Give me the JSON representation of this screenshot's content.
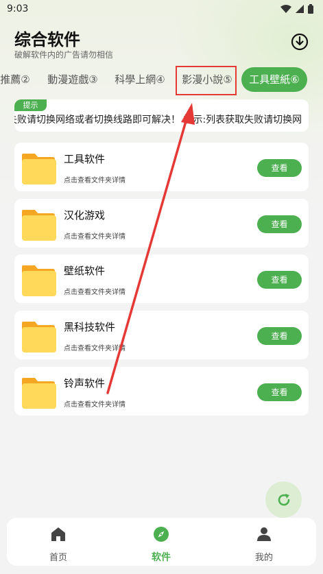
{
  "status_bar": {
    "time": "9:03"
  },
  "header": {
    "title": "综合软件",
    "subtitle": "破解软件内的广告请勿相信"
  },
  "tabs": [
    {
      "label": "推薦②",
      "active": false
    },
    {
      "label": "動漫遊戲③",
      "active": false
    },
    {
      "label": "科學上網④",
      "active": false
    },
    {
      "label": "影漫小說⑤",
      "active": false
    },
    {
      "label": "工具壁紙⑥",
      "active": true
    }
  ],
  "notice": {
    "tag": "提示",
    "text": "失败请切换网络或者切换线路即可解决！ 提示:列表获取失败请切换网"
  },
  "folders": [
    {
      "name": "工具软件",
      "desc": "点击查看文件夹详情",
      "button": "查看"
    },
    {
      "name": "汉化游戏",
      "desc": "点击查看文件夹详情",
      "button": "查看"
    },
    {
      "name": "壁纸软件",
      "desc": "点击查看文件夹详情",
      "button": "查看"
    },
    {
      "name": "黑科技软件",
      "desc": "点击查看文件夹详情",
      "button": "查看"
    },
    {
      "name": "铃声软件",
      "desc": "点击查看文件夹详情",
      "button": "查看"
    }
  ],
  "bottom_nav": [
    {
      "label": "首页",
      "icon": "home-icon",
      "active": false
    },
    {
      "label": "软件",
      "icon": "compass-icon",
      "active": true
    },
    {
      "label": "我的",
      "icon": "user-icon",
      "active": false
    }
  ],
  "colors": {
    "accent": "#4caf50",
    "highlight": "#e53935",
    "folder": "#ffd95a"
  }
}
